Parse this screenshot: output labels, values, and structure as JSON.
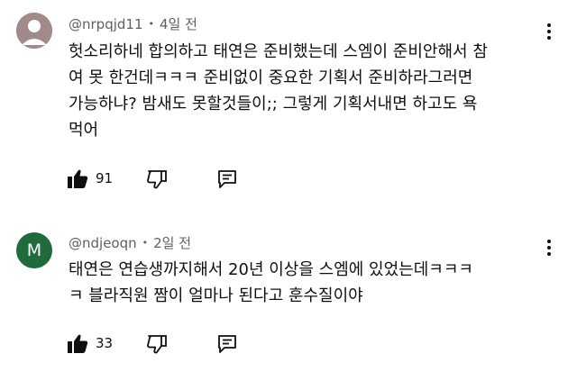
{
  "comments": [
    {
      "avatar_initial": "",
      "avatar_color": "#a08888",
      "handle": "@nrpqjd11",
      "separator": "•",
      "time": "4일 전",
      "lines": [
        "헛소리하네 합의하고 태연은 준비했는데 스엠이 준비안해서 참",
        "여 못 한건데ㅋㅋㅋ 준비없이 중요한 기획서 준비하라그러면",
        "가능하냐? 밤새도 못할것들이;; 그렇게 기획서내면 하고도 욕",
        "먹어"
      ],
      "likes": "91"
    },
    {
      "avatar_initial": "M",
      "avatar_color": "#1f6b3e",
      "handle": "@ndjeoqn",
      "separator": "•",
      "time": "2일 전",
      "lines": [
        "태연은 연습생까지해서 20년 이상을 스엠에 있었는데ㅋㅋㅋ",
        "ㅋ 블라직원 짬이 얼마나 된다고 훈수질이야"
      ],
      "likes": "33"
    }
  ],
  "icons": {
    "like": "thumbs-up-filled-icon",
    "dislike": "thumbs-down-outline-icon",
    "reply": "comment-reply-icon",
    "more": "vertical-ellipsis-icon"
  }
}
